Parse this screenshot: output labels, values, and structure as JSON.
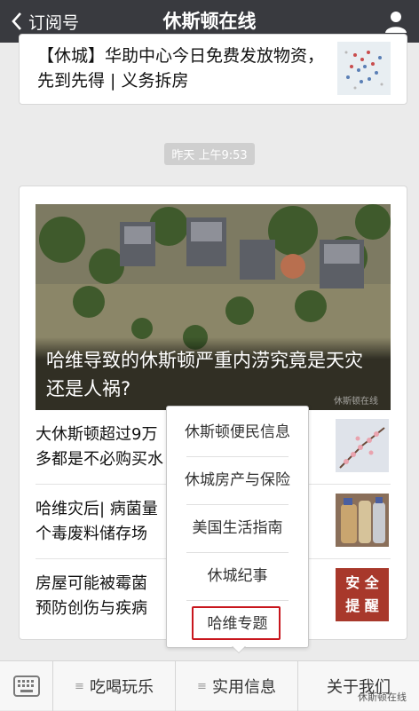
{
  "header": {
    "back_label": "订阅号",
    "title": "休斯顿在线"
  },
  "feed": {
    "top_article": "【休城】华助中心今日免费发放物资，先到先得 | 义务拆房",
    "timestamp": "昨天 上午9:53",
    "hero": {
      "caption": "哈维导致的休斯顿严重内涝究竟是天灾还是人祸?",
      "watermark": "休斯顿在线"
    },
    "articles": [
      {
        "title": "大休斯顿超过9万",
        "title2": "多都是不必购买水"
      },
      {
        "title": "哈维灾后| 病菌量",
        "title2": "个毒废料储存场"
      },
      {
        "title": "房屋可能被霉菌",
        "title2": "预防创伤与疾病"
      }
    ],
    "safety_thumb": {
      "line1": "安 全",
      "line2": "提 醒"
    }
  },
  "popup_menu": {
    "items": [
      "休斯顿便民信息",
      "休城房产与保险",
      "美国生活指南",
      "休城纪事",
      "哈维专题"
    ],
    "highlight_color": "#c8161d"
  },
  "bottom_menu": {
    "items": [
      "吃喝玩乐",
      "实用信息",
      "关于我们"
    ],
    "watermark": "休斯顿在线"
  },
  "colors": {
    "topbar": "#393a3f",
    "background": "#ebebeb"
  }
}
